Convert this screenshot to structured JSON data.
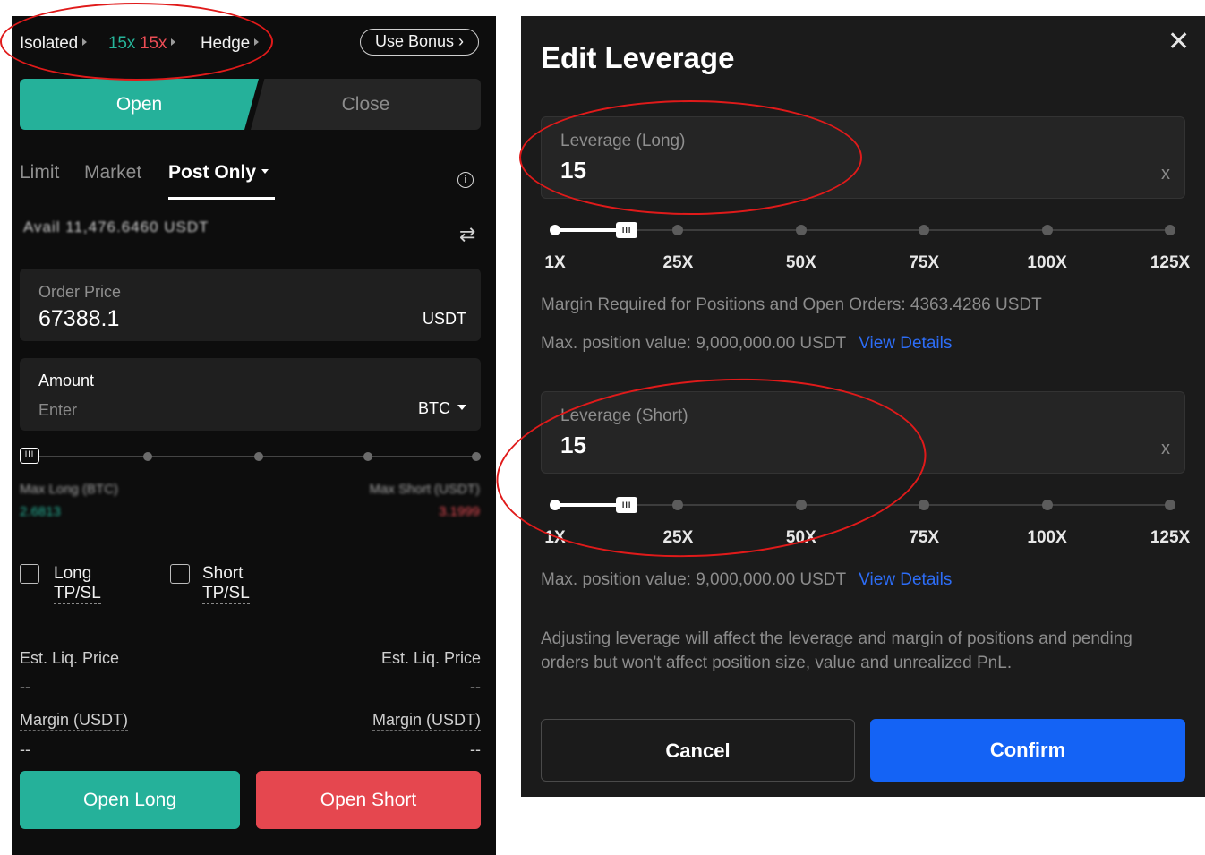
{
  "left_panel": {
    "top_bar": {
      "margin_mode": "Isolated",
      "leverage_long": "15x",
      "leverage_short": "15x",
      "position_mode": "Hedge",
      "bonus_button": "Use Bonus"
    },
    "side_tabs": {
      "open": "Open",
      "close": "Close"
    },
    "order_types": [
      "Limit",
      "Market",
      "Post Only"
    ],
    "available_text": "Avail 11,476.6460 USDT",
    "order_price": {
      "label": "Order Price",
      "value": "67388.1",
      "unit": "USDT"
    },
    "amount": {
      "label": "Amount",
      "placeholder": "Enter",
      "unit": "BTC"
    },
    "max_long": {
      "label": "Max Long (BTC)",
      "value": "2.6813"
    },
    "max_short": {
      "label": "Max Short (USDT)",
      "value": "3.1999"
    },
    "checkboxes": {
      "long_tpsl": "Long TP/SL",
      "short_tpsl": "Short TP/SL"
    },
    "est_liq_label": "Est. Liq. Price",
    "margin_label": "Margin (USDT)",
    "empty_value": "--",
    "buttons": {
      "open_long": "Open Long",
      "open_short": "Open Short"
    }
  },
  "modal": {
    "title": "Edit Leverage",
    "close_icon": "close-icon",
    "long": {
      "label": "Leverage (Long)",
      "value": "15",
      "clear": "x"
    },
    "short": {
      "label": "Leverage (Short)",
      "value": "15",
      "clear": "x"
    },
    "slider_ticks": [
      "1X",
      "25X",
      "50X",
      "75X",
      "100X",
      "125X"
    ],
    "slider_max": 125,
    "slider_level": 15,
    "margin_required": "Margin Required for Positions and Open Orders: 4363.4286 USDT",
    "max_position_long": "Max. position value: 9,000,000.00 USDT",
    "max_position_short": "Max. position value: 9,000,000.00 USDT",
    "view_details": "View Details",
    "note": "Adjusting leverage will affect the leverage and margin of positions and pending orders but won't affect position size, value and unrealized PnL.",
    "cancel": "Cancel",
    "confirm": "Confirm"
  },
  "colors": {
    "accent_green": "#25b19a",
    "accent_red": "#e5474f",
    "link_blue": "#2d6df6",
    "confirm_blue": "#1463f5",
    "annotation_red": "#e01a1a"
  }
}
